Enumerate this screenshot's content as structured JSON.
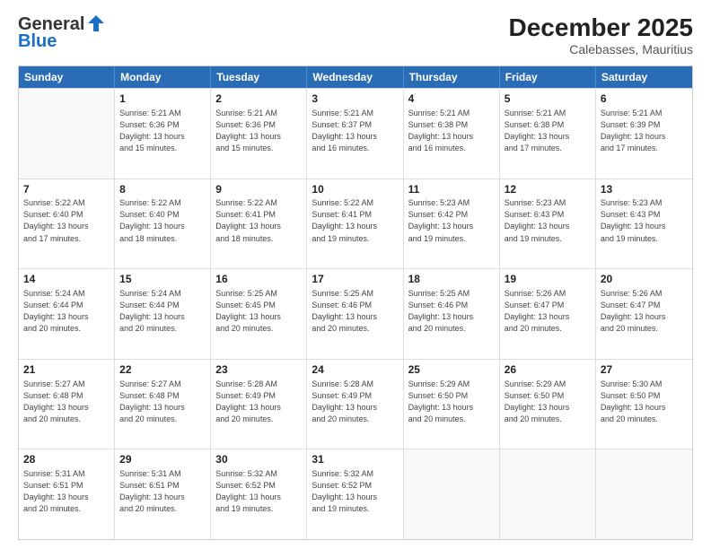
{
  "logo": {
    "line1": "General",
    "line2": "Blue"
  },
  "title": "December 2025",
  "subtitle": "Calebasses, Mauritius",
  "header_days": [
    "Sunday",
    "Monday",
    "Tuesday",
    "Wednesday",
    "Thursday",
    "Friday",
    "Saturday"
  ],
  "weeks": [
    [
      {
        "day": "",
        "text": ""
      },
      {
        "day": "1",
        "text": "Sunrise: 5:21 AM\nSunset: 6:36 PM\nDaylight: 13 hours\nand 15 minutes."
      },
      {
        "day": "2",
        "text": "Sunrise: 5:21 AM\nSunset: 6:36 PM\nDaylight: 13 hours\nand 15 minutes."
      },
      {
        "day": "3",
        "text": "Sunrise: 5:21 AM\nSunset: 6:37 PM\nDaylight: 13 hours\nand 16 minutes."
      },
      {
        "day": "4",
        "text": "Sunrise: 5:21 AM\nSunset: 6:38 PM\nDaylight: 13 hours\nand 16 minutes."
      },
      {
        "day": "5",
        "text": "Sunrise: 5:21 AM\nSunset: 6:38 PM\nDaylight: 13 hours\nand 17 minutes."
      },
      {
        "day": "6",
        "text": "Sunrise: 5:21 AM\nSunset: 6:39 PM\nDaylight: 13 hours\nand 17 minutes."
      }
    ],
    [
      {
        "day": "7",
        "text": "Sunrise: 5:22 AM\nSunset: 6:40 PM\nDaylight: 13 hours\nand 17 minutes."
      },
      {
        "day": "8",
        "text": "Sunrise: 5:22 AM\nSunset: 6:40 PM\nDaylight: 13 hours\nand 18 minutes."
      },
      {
        "day": "9",
        "text": "Sunrise: 5:22 AM\nSunset: 6:41 PM\nDaylight: 13 hours\nand 18 minutes."
      },
      {
        "day": "10",
        "text": "Sunrise: 5:22 AM\nSunset: 6:41 PM\nDaylight: 13 hours\nand 19 minutes."
      },
      {
        "day": "11",
        "text": "Sunrise: 5:23 AM\nSunset: 6:42 PM\nDaylight: 13 hours\nand 19 minutes."
      },
      {
        "day": "12",
        "text": "Sunrise: 5:23 AM\nSunset: 6:43 PM\nDaylight: 13 hours\nand 19 minutes."
      },
      {
        "day": "13",
        "text": "Sunrise: 5:23 AM\nSunset: 6:43 PM\nDaylight: 13 hours\nand 19 minutes."
      }
    ],
    [
      {
        "day": "14",
        "text": "Sunrise: 5:24 AM\nSunset: 6:44 PM\nDaylight: 13 hours\nand 20 minutes."
      },
      {
        "day": "15",
        "text": "Sunrise: 5:24 AM\nSunset: 6:44 PM\nDaylight: 13 hours\nand 20 minutes."
      },
      {
        "day": "16",
        "text": "Sunrise: 5:25 AM\nSunset: 6:45 PM\nDaylight: 13 hours\nand 20 minutes."
      },
      {
        "day": "17",
        "text": "Sunrise: 5:25 AM\nSunset: 6:46 PM\nDaylight: 13 hours\nand 20 minutes."
      },
      {
        "day": "18",
        "text": "Sunrise: 5:25 AM\nSunset: 6:46 PM\nDaylight: 13 hours\nand 20 minutes."
      },
      {
        "day": "19",
        "text": "Sunrise: 5:26 AM\nSunset: 6:47 PM\nDaylight: 13 hours\nand 20 minutes."
      },
      {
        "day": "20",
        "text": "Sunrise: 5:26 AM\nSunset: 6:47 PM\nDaylight: 13 hours\nand 20 minutes."
      }
    ],
    [
      {
        "day": "21",
        "text": "Sunrise: 5:27 AM\nSunset: 6:48 PM\nDaylight: 13 hours\nand 20 minutes."
      },
      {
        "day": "22",
        "text": "Sunrise: 5:27 AM\nSunset: 6:48 PM\nDaylight: 13 hours\nand 20 minutes."
      },
      {
        "day": "23",
        "text": "Sunrise: 5:28 AM\nSunset: 6:49 PM\nDaylight: 13 hours\nand 20 minutes."
      },
      {
        "day": "24",
        "text": "Sunrise: 5:28 AM\nSunset: 6:49 PM\nDaylight: 13 hours\nand 20 minutes."
      },
      {
        "day": "25",
        "text": "Sunrise: 5:29 AM\nSunset: 6:50 PM\nDaylight: 13 hours\nand 20 minutes."
      },
      {
        "day": "26",
        "text": "Sunrise: 5:29 AM\nSunset: 6:50 PM\nDaylight: 13 hours\nand 20 minutes."
      },
      {
        "day": "27",
        "text": "Sunrise: 5:30 AM\nSunset: 6:50 PM\nDaylight: 13 hours\nand 20 minutes."
      }
    ],
    [
      {
        "day": "28",
        "text": "Sunrise: 5:31 AM\nSunset: 6:51 PM\nDaylight: 13 hours\nand 20 minutes."
      },
      {
        "day": "29",
        "text": "Sunrise: 5:31 AM\nSunset: 6:51 PM\nDaylight: 13 hours\nand 20 minutes."
      },
      {
        "day": "30",
        "text": "Sunrise: 5:32 AM\nSunset: 6:52 PM\nDaylight: 13 hours\nand 19 minutes."
      },
      {
        "day": "31",
        "text": "Sunrise: 5:32 AM\nSunset: 6:52 PM\nDaylight: 13 hours\nand 19 minutes."
      },
      {
        "day": "",
        "text": ""
      },
      {
        "day": "",
        "text": ""
      },
      {
        "day": "",
        "text": ""
      }
    ]
  ]
}
